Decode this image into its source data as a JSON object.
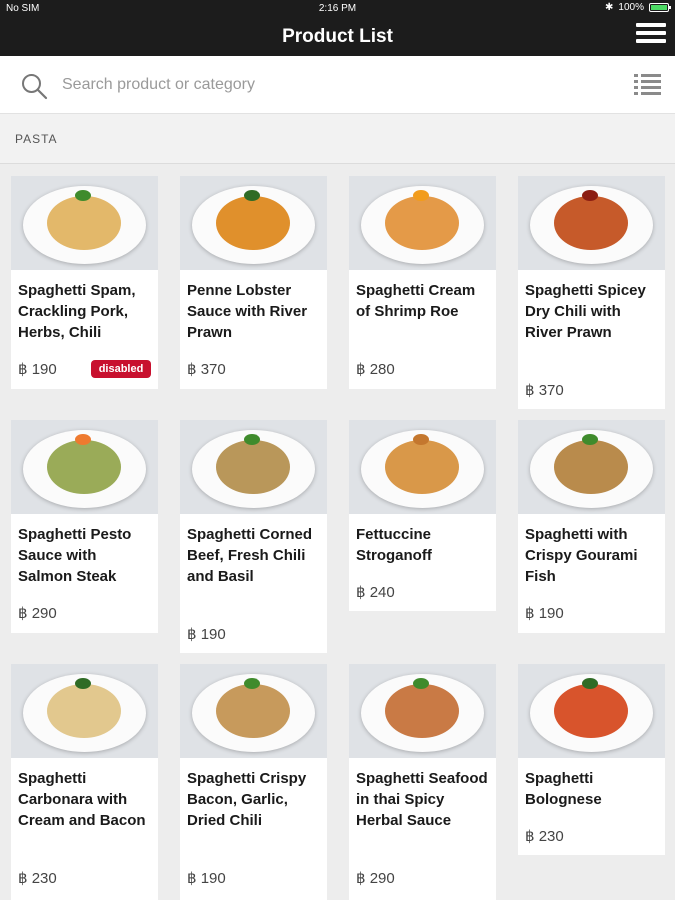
{
  "status_bar": {
    "carrier": "No SIM",
    "time": "2:16 PM",
    "battery": "100%",
    "battery_level": 1.0
  },
  "header": {
    "title": "Product List"
  },
  "search": {
    "placeholder": "Search product or category",
    "value": ""
  },
  "section": {
    "title": "PASTA"
  },
  "colors": {
    "accent": "#c8102e",
    "bar_bg": "#1c1c1c",
    "battery": "#4cd964"
  },
  "products": [
    {
      "name": "Spaghetti Spam, Crackling Pork, Herbs, Chili",
      "price": "฿ 190",
      "badge": "disabled",
      "food_color": "#e3b86a",
      "garnish_color": "#3f8b2c"
    },
    {
      "name": "Penne Lobster Sauce with River Prawn",
      "price": "฿ 370",
      "food_color": "#e0902c",
      "garnish_color": "#2f6b25"
    },
    {
      "name": "Spaghetti Cream of Shrimp Roe",
      "price": "฿ 280",
      "food_color": "#e49a48",
      "garnish_color": "#f29c1b"
    },
    {
      "name": "Spaghetti Spicey Dry Chili with River Prawn",
      "price": "฿ 370",
      "food_color": "#c65a2a",
      "garnish_color": "#8c1d12"
    },
    {
      "name": "Spaghetti Pesto Sauce with Salmon Steak",
      "price": "฿ 290",
      "food_color": "#9aab58",
      "garnish_color": "#ee7a2f"
    },
    {
      "name": "Spaghetti Corned Beef, Fresh Chili and Basil",
      "price": "฿ 190",
      "food_color": "#b9975a",
      "garnish_color": "#3f8b2c"
    },
    {
      "name": "Fettuccine Stroganoff",
      "price": "฿ 240",
      "food_color": "#d99849",
      "garnish_color": "#c4772e"
    },
    {
      "name": "Spaghetti with Crispy Gourami Fish",
      "price": "฿ 190",
      "food_color": "#b98b4c",
      "garnish_color": "#3f8b2c"
    },
    {
      "name": "Spaghetti Carbonara with Cream and Bacon",
      "price": "฿ 230",
      "food_color": "#e2c88e",
      "garnish_color": "#2f6b25"
    },
    {
      "name": "Spaghetti Crispy Bacon, Garlic, Dried Chili",
      "price": "฿ 190",
      "food_color": "#c79a5c",
      "garnish_color": "#3f8b2c"
    },
    {
      "name": "Spaghetti Seafood in thai Spicy Herbal Sauce",
      "price": "฿ 290",
      "food_color": "#c97a45",
      "garnish_color": "#3f8b2c"
    },
    {
      "name": "Spaghetti Bolognese",
      "price": "฿ 230",
      "food_color": "#d8542c",
      "garnish_color": "#2f6b25"
    }
  ]
}
